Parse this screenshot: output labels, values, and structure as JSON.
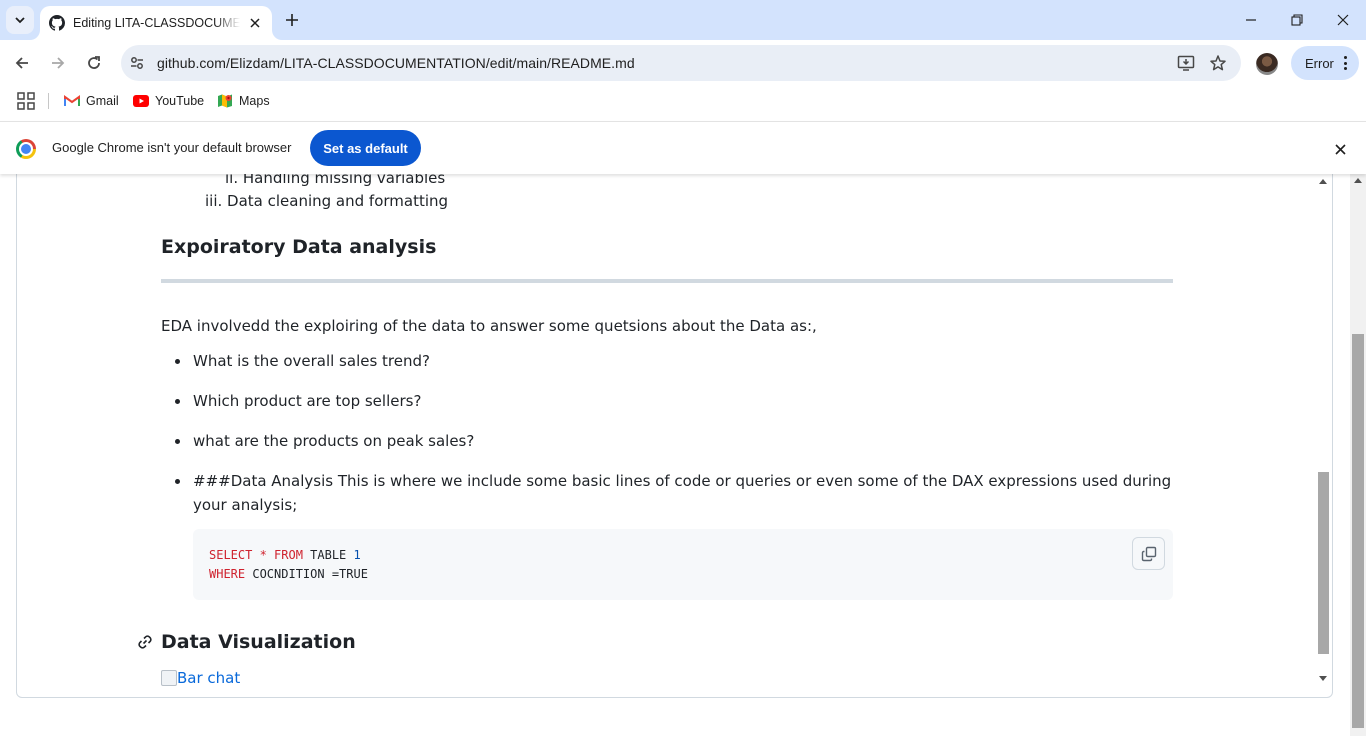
{
  "tab": {
    "title": "Editing LITA-CLASSDOCUMENTATION/README.md at main · Elizdam/LITA-CLASSDOCUMENTATION",
    "favicon": "github-icon"
  },
  "toolbar": {
    "url": "github.com/Elizdam/LITA-CLASSDOCUMENTATION/edit/main/README.md",
    "profile_status": "Error"
  },
  "bookmarks": [
    {
      "label": "Gmail",
      "icon": "gmail-icon"
    },
    {
      "label": "YouTube",
      "icon": "youtube-icon"
    },
    {
      "label": "Maps",
      "icon": "maps-icon"
    }
  ],
  "infobar": {
    "message": "Google Chrome isn't your default browser",
    "button": "Set as default"
  },
  "content": {
    "cut_line": "ii. Handling missing variables",
    "list_item_iii": "iii. Data cleaning and formatting",
    "heading_eda": "Expoiratory Data analysis",
    "eda_paragraph": "EDA involvedd the exploiring of the data to answer some quetsions about the Data as:,",
    "bullets": [
      "What is the overall sales trend?",
      "Which product are top sellers?",
      "what are the products on peak sales?",
      "###Data Analysis This is where we include some basic lines of code or queries or even some of the DAX expressions used during your analysis;"
    ],
    "code": {
      "line1_kw1": "SELECT",
      "line1_kw2": " * FROM",
      "line1_rest": " TABLE ",
      "line1_num": "1",
      "line2_kw": "WHERE",
      "line2_rest": " COCNDITION =TRUE"
    },
    "heading_viz": "Data Visualization",
    "image_alt": "Bar chat"
  },
  "colors": {
    "tabstrip": "#d3e3fd",
    "omnibox": "#e9eef6",
    "primary_button": "#0b57d0",
    "link": "#0969da",
    "code_keyword": "#cf222e",
    "code_number": "#0550ae"
  }
}
